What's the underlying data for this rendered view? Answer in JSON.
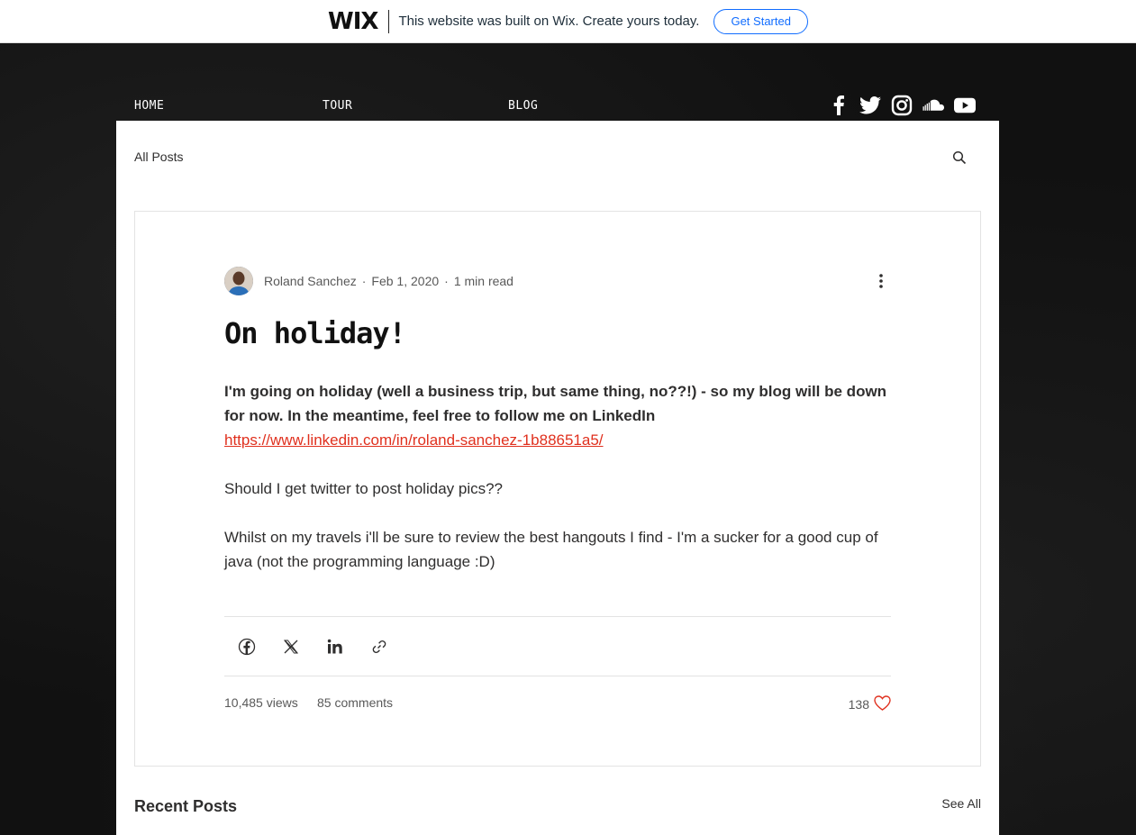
{
  "wix_banner": {
    "logo": "WIX",
    "message": "This website was built on Wix. Create yours today.",
    "cta": "Get Started",
    "accent": "#116dff"
  },
  "nav": {
    "items": [
      "HOME",
      "TOUR",
      "BLOG"
    ],
    "social": [
      "facebook-icon",
      "twitter-icon",
      "instagram-icon",
      "soundcloud-icon",
      "youtube-icon"
    ]
  },
  "blog": {
    "all_posts": "All Posts",
    "search_icon": "search-icon"
  },
  "post": {
    "author": "Roland Sanchez",
    "date": "Feb 1, 2020",
    "read_time": "1 min read",
    "title": "On holiday!",
    "para1_bold": "I'm going on holiday (well a business trip, but same thing, no??!) - so my blog will be down for now. In the meantime, feel free to follow me on LinkedIn",
    "para1_link": "https://www.linkedin.com/in/roland-sanchez-1b88651a5/",
    "para2": "Should I get twitter to post holiday pics??",
    "para3": "Whilst on my travels i'll be sure to review the best hangouts I find - I'm a sucker for a good cup of java (not the programming language :D)",
    "link_color": "#e0301e",
    "views": "10,485 views",
    "comments": "85 comments",
    "likes": "138",
    "like_color": "#e0301e"
  },
  "recent": {
    "title": "Recent Posts",
    "see_all": "See All"
  }
}
